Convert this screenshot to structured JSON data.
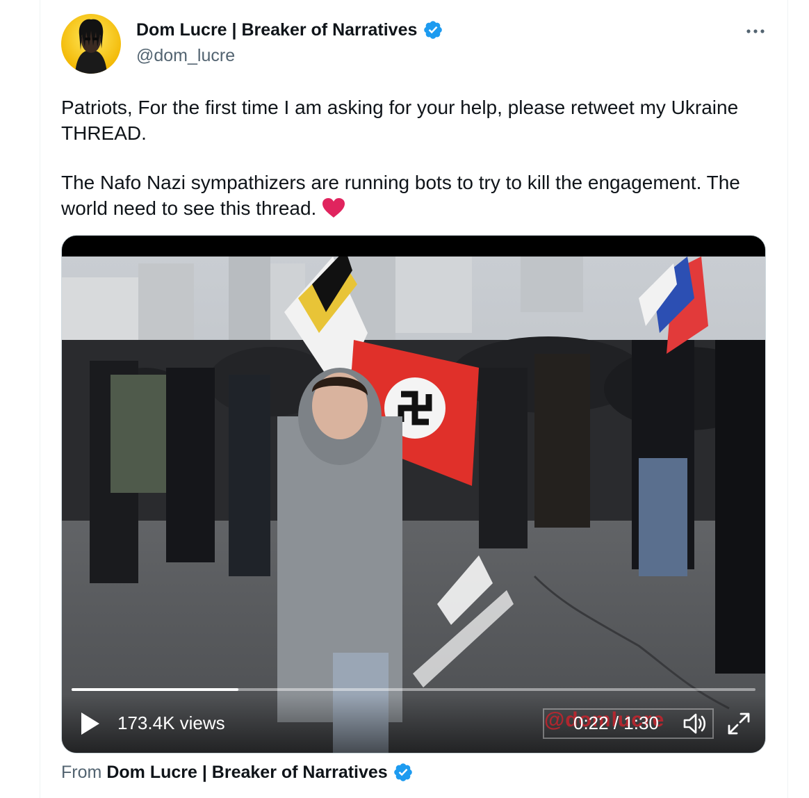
{
  "author": {
    "display_name": "Dom Lucre | Breaker of Narratives",
    "handle": "@dom_lucre",
    "verified": true
  },
  "tweet": {
    "paragraph_1": "Patriots, For the first time I am asking for your help, please retweet my Ukraine THREAD.",
    "paragraph_2": "The Nafo Nazi sympathizers are running bots to try to kill the engagement. The world need to see this thread."
  },
  "video": {
    "views": "173.4K views",
    "timecode": "0:22 / 1:30",
    "watermark": "@domlucre",
    "progress": 0.244
  },
  "attribution": {
    "from_label": "From",
    "from_name": "Dom Lucre | Breaker of Narratives"
  },
  "colors": {
    "verified_blue": "#1d9bf0",
    "heart_red": "#e0245e",
    "text_primary": "#0f1419",
    "text_secondary": "#536471"
  },
  "icons": [
    "verified-badge-icon",
    "more-icon",
    "heart-icon",
    "play-icon",
    "volume-icon",
    "fullscreen-icon"
  ]
}
